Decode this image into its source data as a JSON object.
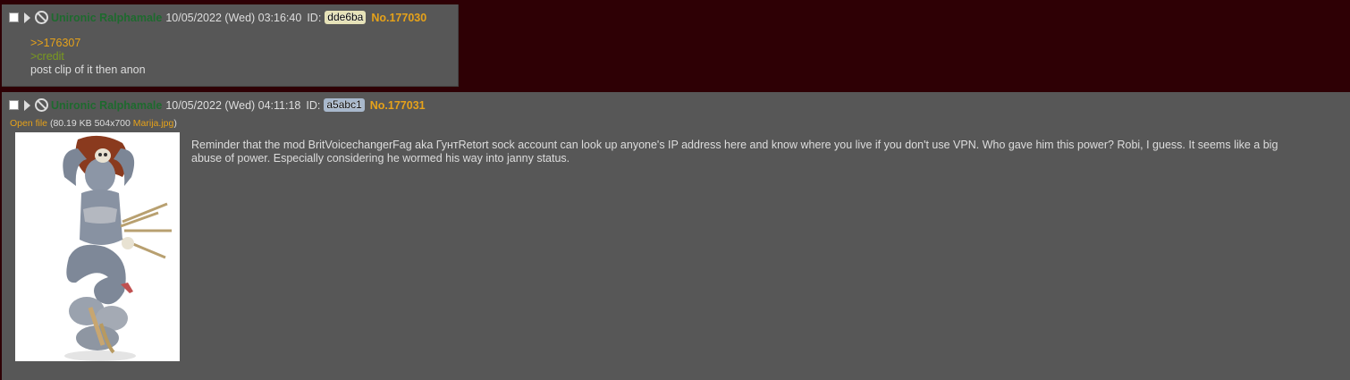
{
  "posts": [
    {
      "name": "Unironic Ralphamale",
      "datetime": "10/05/2022 (Wed) 03:16:40",
      "id_label": "ID:",
      "id": "dde6ba",
      "id_color": "#e6e2b8",
      "number": "No.177030",
      "lines": [
        {
          "type": "quotelink",
          "text": ">>176307"
        },
        {
          "type": "greentext",
          "text": ">credit"
        },
        {
          "type": "text",
          "text": "post clip of it then anon"
        }
      ]
    },
    {
      "name": "Unironic Ralphamale",
      "datetime": "10/05/2022 (Wed) 04:11:18",
      "id_label": "ID:",
      "id": "a5abc1",
      "id_color": "#a8b8cc",
      "number": "No.177031",
      "file": {
        "open_label": "Open file",
        "meta": "(80.19 KB 504x700",
        "filename": "Marija.jpg",
        "close_paren": ")",
        "thumbnail_alt": "illustration of a figure with skulls"
      },
      "message": "Reminder that the mod BritVoicechangerFag aka ГунтRetort sock account can look up anyone's IP address here and know where you live if you don't use VPN. Who gave him this power? Robi, I guess. It seems like a big abuse of power. Especially considering he wormed his way into janny status."
    }
  ],
  "colors": {
    "page_bg": "#2e0005",
    "post_bg": "#575757",
    "name": "#1e6a2e",
    "post_number": "#e6a21a",
    "quotelink": "#e6a21a",
    "greentext": "#7a9a1e"
  },
  "icons": [
    "checkbox",
    "expand-triangle-icon",
    "hide-icon"
  ]
}
